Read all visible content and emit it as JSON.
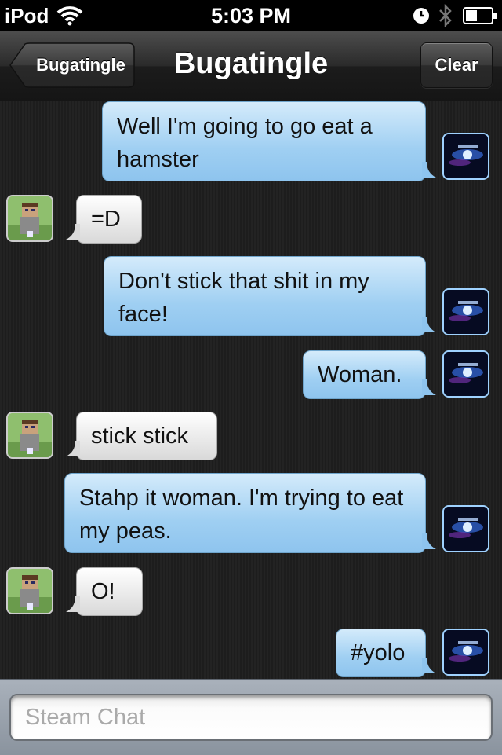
{
  "status_bar": {
    "carrier": "iPod",
    "time": "5:03 PM"
  },
  "nav": {
    "back_label": "Bugatingle",
    "title": "Bugatingle",
    "clear_label": "Clear"
  },
  "messages": [
    {
      "from": "me",
      "text": "Well I'm going to go eat a hamster"
    },
    {
      "from": "friend",
      "text": "=D"
    },
    {
      "from": "me",
      "text": "Don't stick that shit in my face!"
    },
    {
      "from": "me",
      "text": "Woman."
    },
    {
      "from": "friend",
      "text": "stick stick"
    },
    {
      "from": "me",
      "text": "Stahp it woman. I'm trying to eat my peas."
    },
    {
      "from": "friend",
      "text": "O!"
    },
    {
      "from": "me",
      "text": "#yolo"
    }
  ],
  "input": {
    "placeholder": "Steam Chat",
    "value": ""
  },
  "colors": {
    "outgoing_bubble": "#9fcff2",
    "incoming_bubble": "#e8e8e8",
    "nav_bar": "#2a2a2a",
    "input_bar": "#8a939e"
  },
  "icons": [
    "wifi-icon",
    "clock-icon",
    "bluetooth-icon",
    "battery-icon",
    "back-arrow-icon"
  ]
}
